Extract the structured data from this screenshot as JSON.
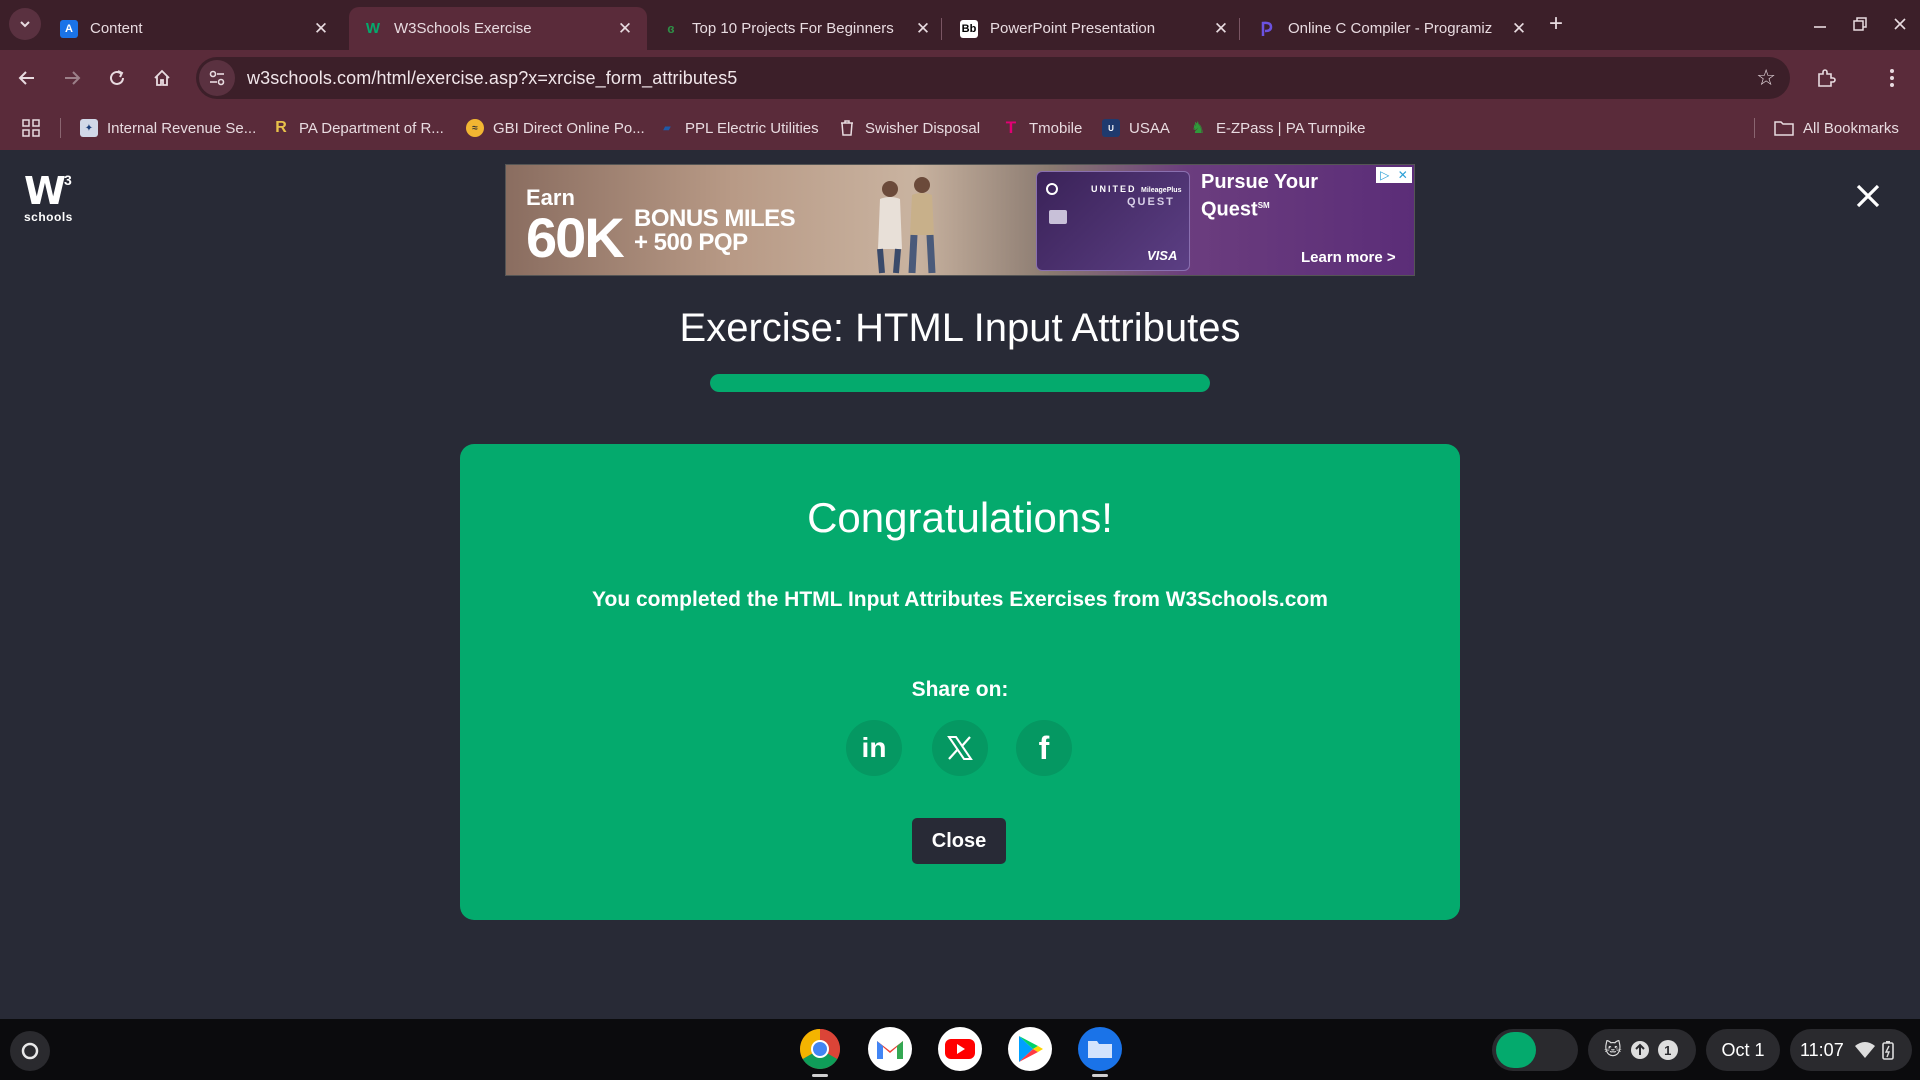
{
  "tabs": [
    {
      "title": "Content",
      "favicon": "A",
      "favicon_color": "#1a73e8"
    },
    {
      "title": "W3Schools Exercise",
      "favicon": "W",
      "favicon_color": "#04aa6d"
    },
    {
      "title": "Top 10 Projects For Beginners",
      "favicon": "gfg",
      "favicon_color": "#2f8d46"
    },
    {
      "title": "PowerPoint Presentation",
      "favicon": "Bb",
      "favicon_color": "#ffffff"
    },
    {
      "title": "Online C Compiler - Programiz",
      "favicon": "programiz",
      "favicon_color": "#5b3fd8"
    }
  ],
  "toolbar": {
    "url": "w3schools.com/html/exercise.asp?x=xrcise_form_attributes5"
  },
  "bookmarks": [
    {
      "label": "Internal Revenue Se...",
      "icon": "irs-icon"
    },
    {
      "label": "PA Department of R...",
      "icon": "pa-revenue-icon"
    },
    {
      "label": "GBI Direct Online Po...",
      "icon": "gbi-icon"
    },
    {
      "label": "PPL Electric Utilities",
      "icon": "ppl-icon"
    },
    {
      "label": "Swisher Disposal",
      "icon": "trash-icon"
    },
    {
      "label": "Tmobile",
      "icon": "tmobile-icon"
    },
    {
      "label": "USAA",
      "icon": "usaa-icon"
    },
    {
      "label": "E-ZPass | PA Turnpike",
      "icon": "ezpass-icon"
    }
  ],
  "all_bookmarks": "All Bookmarks",
  "logo": {
    "mark": "W",
    "sup": "3",
    "text": "schools"
  },
  "ad": {
    "earn": "Earn",
    "big": "60K",
    "bonus_line1": "BONUS MILES",
    "bonus_line2": "+ 500 PQP",
    "card_brand": "UNITED",
    "card_brand_small": "MileagePlus",
    "card_name": "QUEST",
    "card_network": "VISA",
    "headline_line1": "Pursue Your",
    "headline_line2": "Quest",
    "headline_mark": "SM",
    "cta": "Learn more >"
  },
  "exercise": {
    "title": "Exercise: HTML Input Attributes",
    "progress": 1.0,
    "accent": "#04aa6d"
  },
  "modal": {
    "heading": "Congratulations!",
    "message": "You completed the HTML Input Attributes Exercises from W3Schools.com",
    "share_label": "Share on:",
    "share": [
      {
        "network": "linkedin",
        "glyph": "in"
      },
      {
        "network": "x",
        "glyph": "X"
      },
      {
        "network": "facebook",
        "glyph": "f"
      }
    ],
    "close_label": "Close"
  },
  "shelf": {
    "apps": [
      "chrome-icon",
      "gmail-icon",
      "youtube-icon",
      "play-store-icon",
      "files-icon"
    ],
    "notification_count": "1",
    "date": "Oct 1",
    "time": "11:07"
  }
}
